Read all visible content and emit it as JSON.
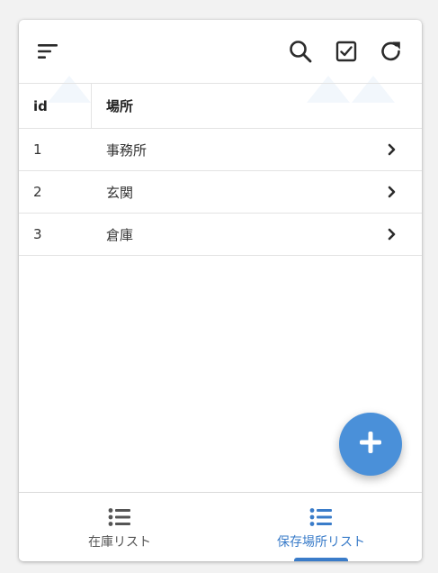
{
  "table": {
    "headers": {
      "id": "id",
      "place": "場所"
    },
    "rows": [
      {
        "id": "1",
        "place": "事務所"
      },
      {
        "id": "2",
        "place": "玄関"
      },
      {
        "id": "3",
        "place": "倉庫"
      }
    ]
  },
  "toolbar": {
    "icons": [
      "sort-icon",
      "search-icon",
      "check-square-icon",
      "refresh-icon"
    ]
  },
  "fab": {
    "icon": "plus-icon",
    "color": "#4a90d9"
  },
  "bottom_nav": {
    "items": [
      {
        "label": "在庫リスト",
        "icon": "list-icon",
        "active": false
      },
      {
        "label": "保存場所リスト",
        "icon": "list-icon",
        "active": true
      }
    ],
    "active_color": "#3a7cc9"
  }
}
